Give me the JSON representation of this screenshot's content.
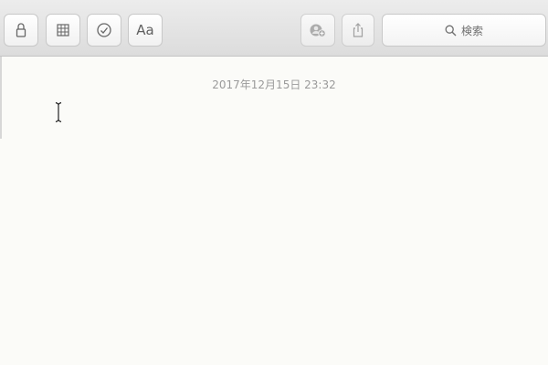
{
  "toolbar": {
    "buttons": [
      {
        "name": "lock",
        "icon": "lock-icon"
      },
      {
        "name": "table",
        "icon": "table-icon"
      },
      {
        "name": "checklist",
        "icon": "checkmark-circle-icon"
      },
      {
        "name": "format",
        "icon": "text-format-icon",
        "label": "Aa"
      },
      {
        "name": "add-people",
        "icon": "add-people-icon"
      },
      {
        "name": "share",
        "icon": "share-icon"
      }
    ],
    "search": {
      "icon": "search-icon",
      "label": "検索"
    }
  },
  "note": {
    "timestamp": "2017年12月15日 23:32",
    "body": ""
  },
  "colors": {
    "toolbar_bg": "#e4e4e4",
    "note_bg": "#fbfbf9",
    "timestamp": "#9a9a9a"
  }
}
